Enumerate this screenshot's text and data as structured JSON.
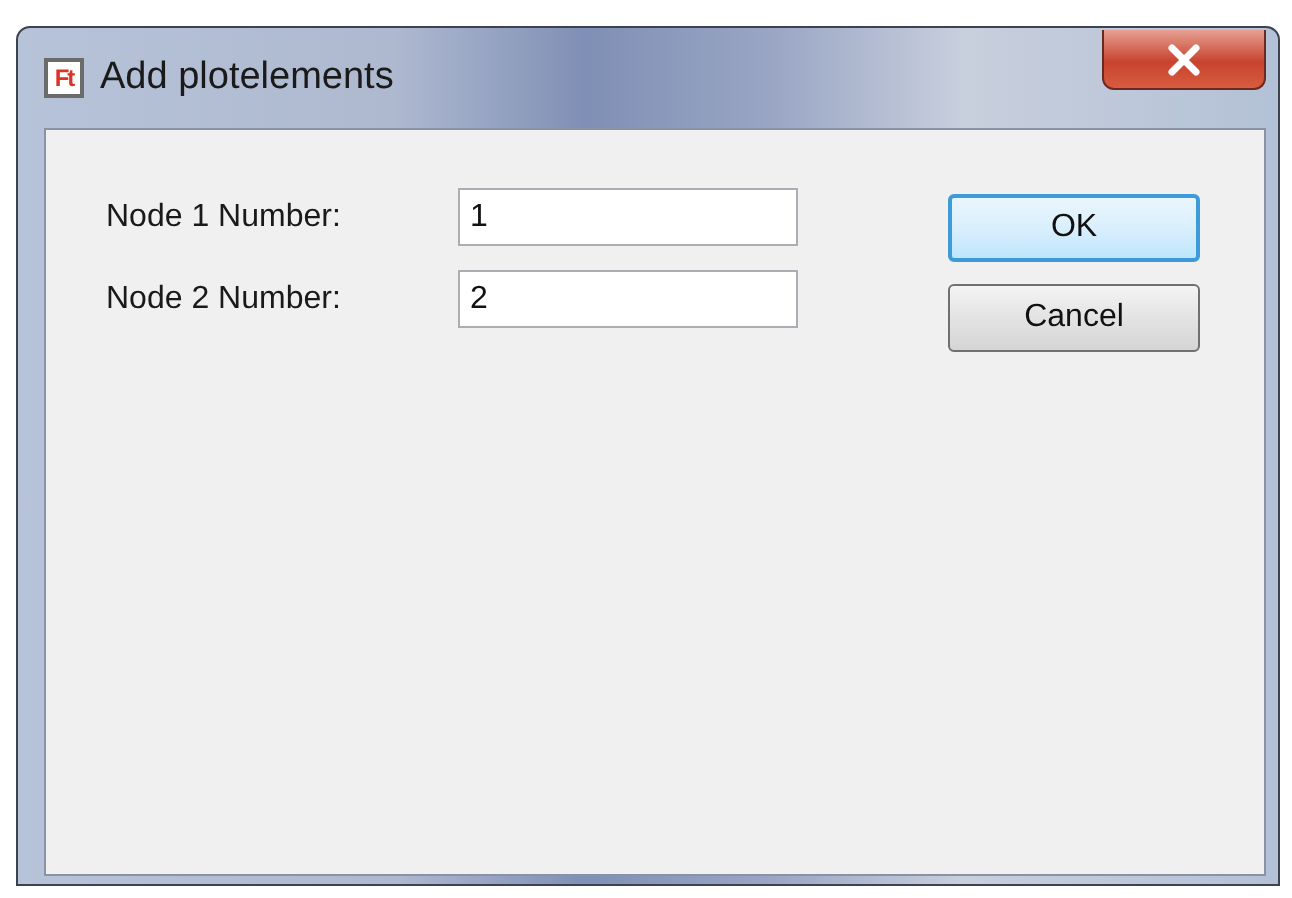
{
  "window": {
    "icon_text": "Ft",
    "title": "Add plotelements"
  },
  "fields": [
    {
      "label": "Node 1 Number:",
      "value": "1"
    },
    {
      "label": "Node 2 Number:",
      "value": "2"
    }
  ],
  "buttons": [
    {
      "label": "OK",
      "default": true
    },
    {
      "label": "Cancel",
      "default": false
    }
  ]
}
